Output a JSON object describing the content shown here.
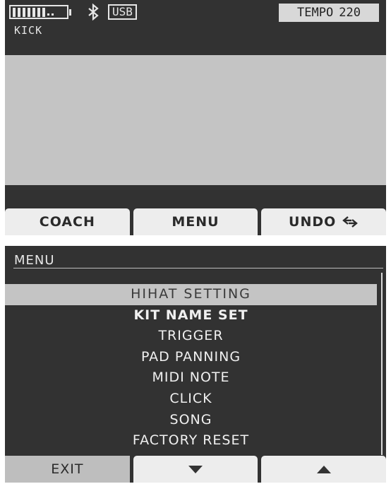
{
  "main_screen": {
    "battery_icon": "battery-icon",
    "bluetooth_icon": "bluetooth-icon",
    "usb_label": "USB",
    "instrument": "KICK",
    "tempo_label": "TEMPO",
    "tempo_value": "220",
    "softkeys": {
      "coach": "COACH",
      "menu": "MENU",
      "undo": "UNDO",
      "undo_icon": "undo-arrow-icon"
    }
  },
  "menu_screen": {
    "title": "MENU",
    "items": [
      {
        "label": "HIHAT SETTING"
      },
      {
        "label": "KIT NAME SET"
      },
      {
        "label": "TRIGGER"
      },
      {
        "label": "PAD PANNING"
      },
      {
        "label": "MIDI NOTE"
      },
      {
        "label": "CLICK"
      },
      {
        "label": "SONG"
      },
      {
        "label": "FACTORY RESET"
      }
    ],
    "selected_index": 0,
    "softkeys": {
      "exit": "EXIT",
      "down_icon": "arrow-down-icon",
      "up_icon": "arrow-up-icon"
    }
  },
  "colors": {
    "screen_bg": "#323232",
    "highlight": "#c4c4c4",
    "button": "#ededed"
  }
}
